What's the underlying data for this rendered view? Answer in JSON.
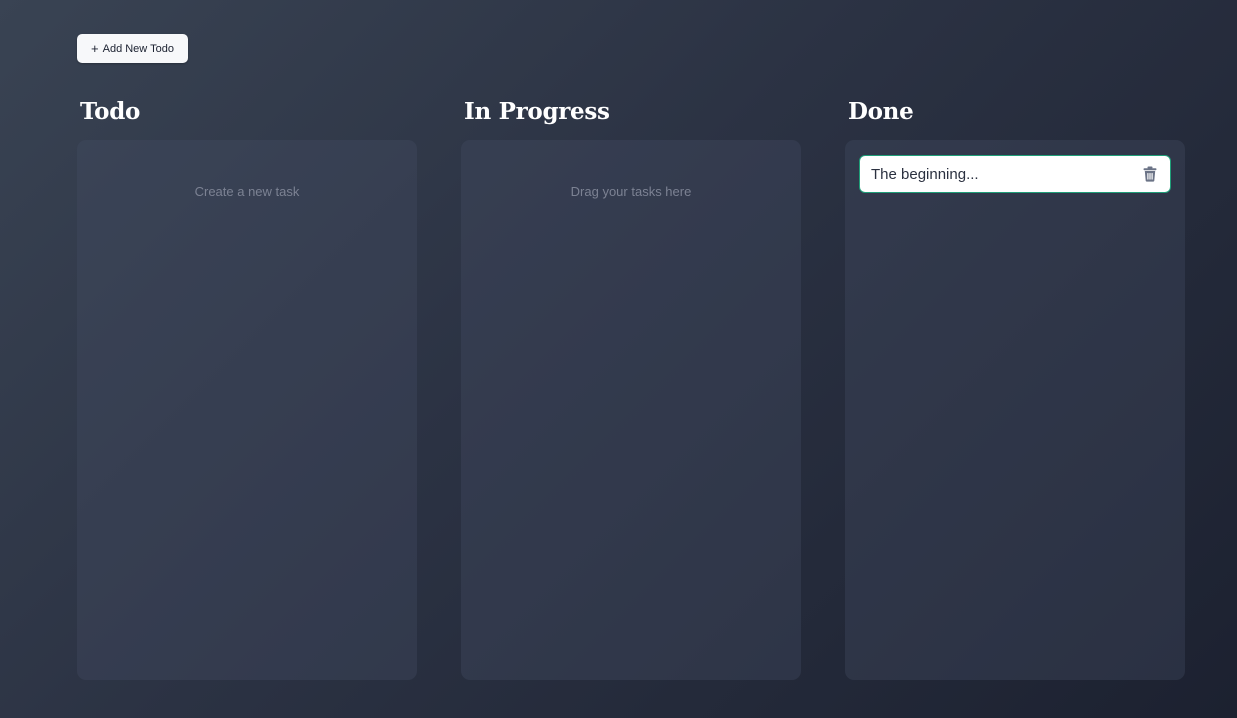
{
  "toolbar": {
    "add_button_label": "Add New Todo",
    "add_button_icon": "plus-icon"
  },
  "columns": [
    {
      "title": "Todo",
      "empty_hint": "Create a new task",
      "cards": []
    },
    {
      "title": "In Progress",
      "empty_hint": "Drag your tasks here",
      "cards": []
    },
    {
      "title": "Done",
      "empty_hint": "",
      "cards": [
        {
          "text": "The beginning...",
          "action_icon": "trash-icon"
        }
      ]
    }
  ],
  "colors": {
    "card_border": "#1f9e78",
    "card_background": "#ffffff",
    "title_text": "#ffffff",
    "hint_text": "#7c8293"
  }
}
